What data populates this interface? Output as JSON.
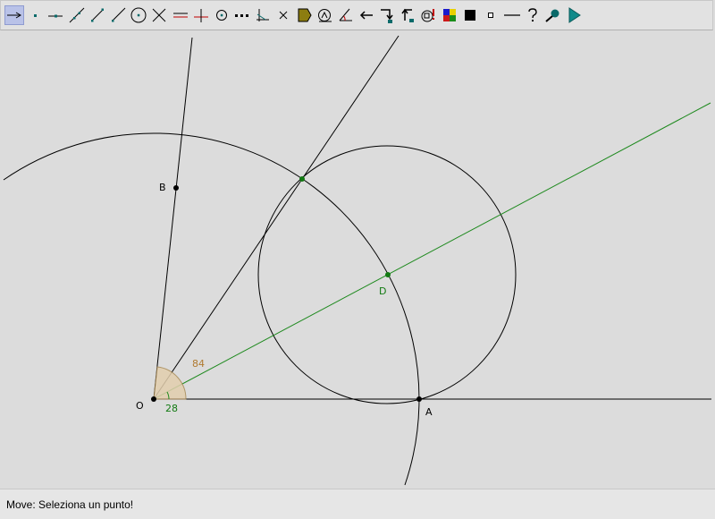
{
  "toolbar": {
    "selected_tool": "move-tool",
    "tools": [
      "move-tool",
      "point-tool",
      "point-on-object-tool",
      "line-tool",
      "segment-tool",
      "ray-tool",
      "circle-tool",
      "intersection-tool",
      "parallel-tool",
      "perpendicular-tool",
      "midpoint-tool",
      "dashed-line-tool",
      "axis-tool",
      "delete-tool",
      "polygon-tool",
      "compass-tool",
      "angle-tool",
      "undo-tool",
      "redo-tool",
      "macro-tool",
      "info-tool",
      "color-tool",
      "fill-tool",
      "point-style-tool",
      "line-style-tool",
      "help-tool",
      "zoom-tool",
      "play-tool"
    ]
  },
  "canvas": {
    "labels": {
      "point_b": "B",
      "point_o": "O",
      "point_a": "A",
      "point_d": "D",
      "angle_big": "84",
      "angle_small": "28"
    },
    "colors": {
      "background": "#dcdcdc",
      "line": "#000000",
      "bisector": "#1f8a1f",
      "angle_label": "#b07a30",
      "angle_fill": "#e3cfae"
    }
  },
  "status": {
    "text": "Move: Seleziona un punto!"
  }
}
